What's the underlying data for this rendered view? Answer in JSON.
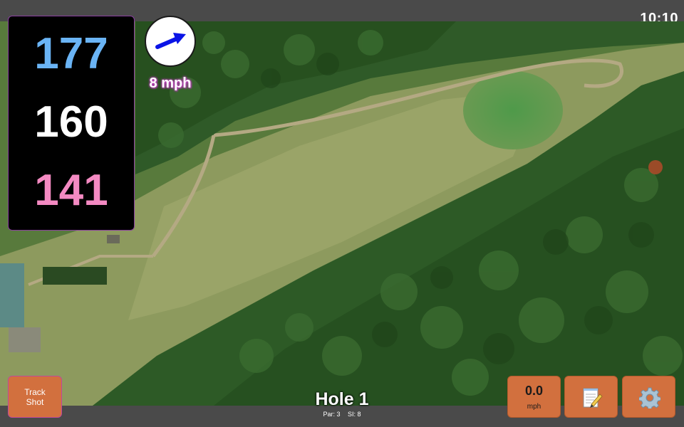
{
  "status_bar": {
    "time": "10:10"
  },
  "distances": {
    "back": "177",
    "middle": "160",
    "front": "141"
  },
  "colors": {
    "back": "#6ab4f5",
    "middle": "#ffffff",
    "front": "#f48ac2",
    "button": "#d2703e",
    "wind_arrow": "#0a14e6"
  },
  "wind": {
    "icon": "wind-direction-arrow-icon",
    "speed_text": "8 mph"
  },
  "hole": {
    "title": "Hole 1",
    "par_label": "Par: 3",
    "si_label": "SI: 8"
  },
  "buttons": {
    "track_shot_line1": "Track",
    "track_shot_line2": "Shot",
    "speed_value": "0.0",
    "speed_unit": "mph",
    "notes_icon": "notepad-pencil-icon",
    "settings_icon": "gear-icon"
  },
  "map": {
    "type": "satellite-view"
  }
}
